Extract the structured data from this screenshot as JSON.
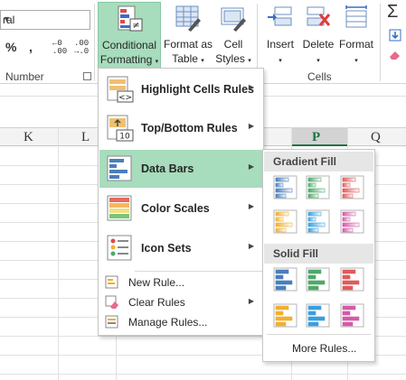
{
  "ribbon": {
    "number_format_value": "ral",
    "percent_label": "%",
    "comma_label": ",",
    "increase_decimal": {
      "line1": "←0",
      "line2": ".00"
    },
    "decrease_decimal": {
      "line1": ".00",
      "line2": "→.0"
    },
    "number_group_label": "Number",
    "cells_group_label": "Cells",
    "buttons": {
      "conditional_formatting": {
        "line1": "Conditional",
        "line2": "Formatting",
        "caret": "▾"
      },
      "format_as_table": {
        "line1": "Format as",
        "line2": "Table",
        "caret": "▾"
      },
      "cell_styles": {
        "line1": "Cell",
        "line2": "Styles",
        "caret": "▾"
      },
      "insert": {
        "line1": "Insert",
        "caret": "▾"
      },
      "delete": {
        "line1": "Delete",
        "caret": "▾"
      },
      "format": {
        "line1": "Format",
        "caret": "▾"
      }
    },
    "autosum_icon": "sigma-icon",
    "fill_icon": "fill-down-icon",
    "clear_icon": "eraser-icon"
  },
  "sheet": {
    "columns": [
      "K",
      "L",
      "P",
      "Q"
    ],
    "selected_column": "P",
    "accent": "#217346"
  },
  "cf_menu": {
    "items": [
      {
        "label": "Highlight Cells Rules",
        "icon": "highlight-cells-icon"
      },
      {
        "label": "Top/Bottom Rules",
        "icon": "top-bottom-icon",
        "icon_number": "10"
      },
      {
        "label": "Data Bars",
        "icon": "data-bars-icon"
      },
      {
        "label": "Color Scales",
        "icon": "color-scales-icon"
      },
      {
        "label": "Icon Sets",
        "icon": "icon-sets-icon"
      }
    ],
    "small_items": [
      {
        "label": "New Rule...",
        "icon": "new-rule-icon"
      },
      {
        "label": "Clear Rules",
        "icon": "clear-rules-icon"
      },
      {
        "label": "Manage Rules...",
        "icon": "manage-rules-icon"
      }
    ],
    "submenu_arrow": "▶",
    "highlight_color": "#a7dcbc"
  },
  "data_bars_menu": {
    "gradient_header": "Gradient Fill",
    "solid_header": "Solid Fill",
    "colors": [
      "#4a7ebb",
      "#4ea86a",
      "#e05a5a",
      "#f0b030",
      "#3a9ee0",
      "#d45aa8"
    ],
    "more_rules": "More Rules..."
  }
}
